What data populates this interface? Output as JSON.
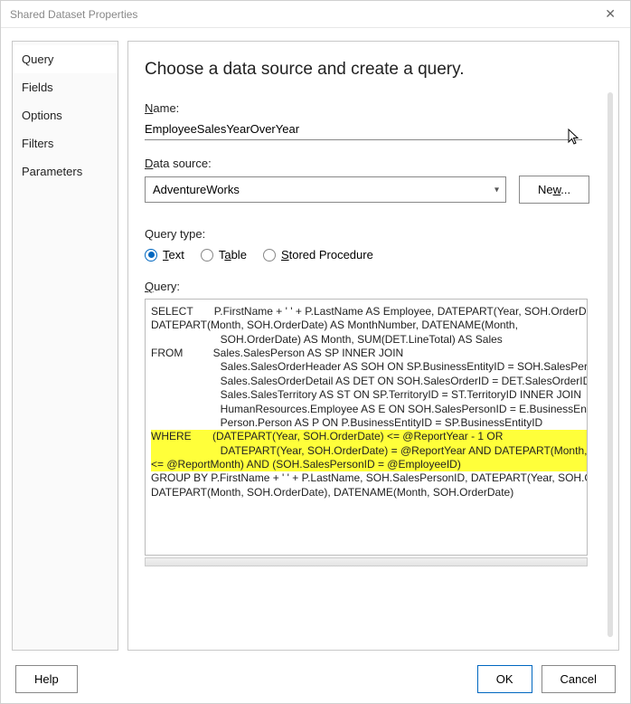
{
  "window": {
    "title": "Shared Dataset Properties"
  },
  "nav": {
    "items": [
      {
        "label": "Query"
      },
      {
        "label": "Fields"
      },
      {
        "label": "Options"
      },
      {
        "label": "Filters"
      },
      {
        "label": "Parameters"
      }
    ]
  },
  "pane": {
    "heading": "Choose a data source and create a query.",
    "name_label_pre": "N",
    "name_label_post": "ame:",
    "name_value": "EmployeeSalesYearOverYear",
    "ds_label_pre": "D",
    "ds_label_post": "ata source:",
    "ds_value": "AdventureWorks",
    "new_btn_pre": "Ne",
    "new_btn_u": "w",
    "new_btn_post": "...",
    "qt_label": "Query type:",
    "qt_options": {
      "text_pre": "T",
      "text_post": "ext",
      "table_pre": "T",
      "table_u": "a",
      "table_post": "ble",
      "sp_pre": "S",
      "sp_post": "tored Procedure"
    },
    "query_label_pre": "Q",
    "query_label_post": "uery:",
    "query_text": {
      "l1": "SELECT       P.FirstName + ' ' + P.LastName AS Employee, DATEPART(Year, SOH.OrderDate) A",
      "l2": "DATEPART(Month, SOH.OrderDate) AS MonthNumber, DATENAME(Month,",
      "l3": "                       SOH.OrderDate) AS Month, SUM(DET.LineTotal) AS Sales",
      "l4": "FROM          Sales.SalesPerson AS SP INNER JOIN",
      "l5": "                       Sales.SalesOrderHeader AS SOH ON SP.BusinessEntityID = SOH.SalesPersonID",
      "l6": "                       Sales.SalesOrderDetail AS DET ON SOH.SalesOrderID = DET.SalesOrderID INNE",
      "l7": "                       Sales.SalesTerritory AS ST ON SP.TerritoryID = ST.TerritoryID INNER JOIN",
      "l8": "                       HumanResources.Employee AS E ON SOH.SalesPersonID = E.BusinessEntityID",
      "l9": "                       Person.Person AS P ON P.BusinessEntityID = SP.BusinessEntityID",
      "h1": "WHERE       (DATEPART(Year, SOH.OrderDate) <= @ReportYear - 1 OR",
      "h2": "                       DATEPART(Year, SOH.OrderDate) = @ReportYear AND DATEPART(Month, SOH.",
      "h3": "<= @ReportMonth) AND (SOH.SalesPersonID = @EmployeeID)",
      "l10": "GROUP BY P.FirstName + ' ' + P.LastName, SOH.SalesPersonID, DATEPART(Year, SOH.OrderD",
      "l11": "DATEPART(Month, SOH.OrderDate), DATENAME(Month, SOH.OrderDate)"
    }
  },
  "footer": {
    "help": "Help",
    "ok": "OK",
    "cancel": "Cancel"
  }
}
